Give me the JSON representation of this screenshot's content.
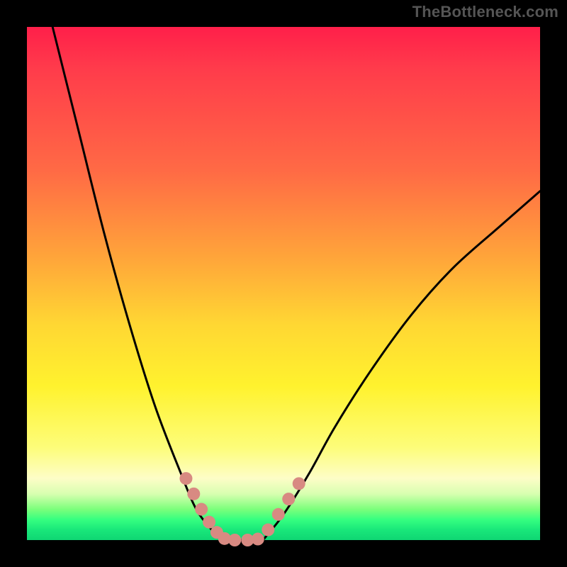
{
  "attribution": "TheBottleneck.com",
  "chart_data": {
    "type": "line",
    "title": "",
    "xlabel": "",
    "ylabel": "",
    "xlim": [
      0,
      100
    ],
    "ylim": [
      0,
      100
    ],
    "series": [
      {
        "name": "left-curve",
        "x": [
          5,
          10,
          15,
          20,
          25,
          30,
          33,
          36,
          38
        ],
        "y": [
          100,
          80,
          60,
          42,
          26,
          13,
          6,
          2,
          0
        ]
      },
      {
        "name": "floor",
        "x": [
          38,
          46
        ],
        "y": [
          0,
          0
        ]
      },
      {
        "name": "right-curve",
        "x": [
          46,
          50,
          55,
          60,
          67,
          75,
          83,
          92,
          100
        ],
        "y": [
          0,
          5,
          13,
          22,
          33,
          44,
          53,
          61,
          68
        ]
      }
    ],
    "markers": {
      "name": "highlight-dots",
      "color": "#d88a82",
      "points": [
        {
          "x": 31.0,
          "y": 12.0
        },
        {
          "x": 32.5,
          "y": 9.0
        },
        {
          "x": 34.0,
          "y": 6.0
        },
        {
          "x": 35.5,
          "y": 3.5
        },
        {
          "x": 37.0,
          "y": 1.5
        },
        {
          "x": 38.5,
          "y": 0.3
        },
        {
          "x": 40.5,
          "y": 0.0
        },
        {
          "x": 43.0,
          "y": 0.0
        },
        {
          "x": 45.0,
          "y": 0.2
        },
        {
          "x": 47.0,
          "y": 2.0
        },
        {
          "x": 49.0,
          "y": 5.0
        },
        {
          "x": 51.0,
          "y": 8.0
        },
        {
          "x": 53.0,
          "y": 11.0
        }
      ]
    },
    "gradient_stops": [
      {
        "pos": 0.0,
        "color": "#ff1f4a"
      },
      {
        "pos": 0.45,
        "color": "#ffa53a"
      },
      {
        "pos": 0.7,
        "color": "#fff22e"
      },
      {
        "pos": 0.92,
        "color": "#d8ffb0"
      },
      {
        "pos": 1.0,
        "color": "#0fd673"
      }
    ]
  }
}
